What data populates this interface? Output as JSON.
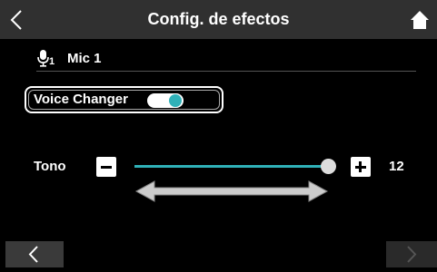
{
  "header": {
    "title": "Config. de efectos",
    "back_icon": "chevron-left-icon",
    "home_icon": "home-icon"
  },
  "mic": {
    "number": "1",
    "label": "Mic 1",
    "icon": "microphone-icon"
  },
  "voice_changer": {
    "label": "Voice Changer",
    "enabled": true,
    "accent_color": "#2fb1b8"
  },
  "tono": {
    "label": "Tono",
    "value": "12",
    "minus_icon": "minus-icon",
    "plus_icon": "plus-icon",
    "level": 1.0
  },
  "footer": {
    "prev_icon": "chevron-left-icon",
    "next_icon": "chevron-right-icon"
  }
}
